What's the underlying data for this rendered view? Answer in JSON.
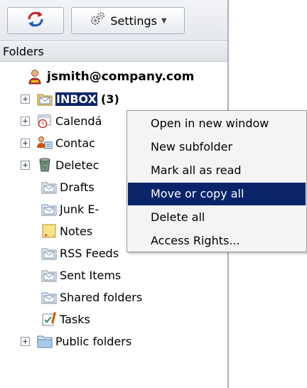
{
  "toolbar": {
    "refresh_icon": "refresh-icon",
    "settings_icon": "gear-icon",
    "settings_label": "Settings"
  },
  "folders_header": "Folders",
  "tree": {
    "account": "jsmith@company.com",
    "inbox": {
      "label": "INBOX",
      "count": "(3)"
    },
    "calendar": "Calendá",
    "contacts": "Contac",
    "deleted": "Deletec",
    "drafts": "Drafts",
    "junk": "Junk E-",
    "notes": "Notes",
    "rss": "RSS Feeds",
    "sent": "Sent Items",
    "shared": "Shared folders",
    "tasks": "Tasks",
    "public": "Public folders"
  },
  "context_menu": {
    "items": [
      "Open in new window",
      "New subfolder",
      "Mark all as read",
      "Move or copy all",
      "Delete all",
      "Access Rights..."
    ],
    "active_index": 3
  },
  "colors": {
    "selection": "#0a246a",
    "folder": "#e8c660"
  }
}
